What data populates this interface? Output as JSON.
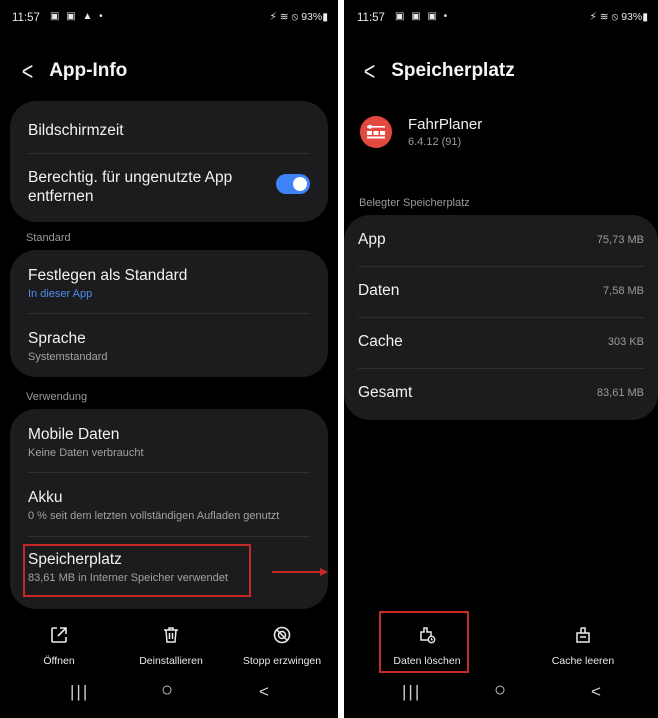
{
  "left": {
    "status": {
      "time": "11:57",
      "icons": "▣ ▣ ▲ •",
      "right": "⚡ ≋ ⦸ 93%▮"
    },
    "title": "App-Info",
    "items": {
      "screen_time": "Bildschirmzeit",
      "perm_remove": "Berechtig. für ungenutzte App entfernen",
      "set_default": "Festlegen als Standard",
      "set_default_sub": "In dieser App",
      "language": "Sprache",
      "language_sub": "Systemstandard",
      "mobile_data": "Mobile Daten",
      "mobile_data_sub": "Keine Daten verbraucht",
      "battery": "Akku",
      "battery_sub": "0 % seit dem letzten vollständigen Aufladen genutzt",
      "storage": "Speicherplatz",
      "storage_sub": "83,61 MB in Interner Speicher verwendet"
    },
    "toggle_on": true,
    "sections": {
      "standard": "Standard",
      "usage": "Verwendung"
    },
    "bottom": {
      "open": "Öffnen",
      "uninstall": "Deinstallieren",
      "force_stop": "Stopp erzwingen"
    },
    "icons": {
      "open": "open-icon",
      "uninstall": "trash-icon",
      "stop": "stop-icon"
    }
  },
  "right": {
    "status": {
      "time": "11:57",
      "icons": "▣ ▣ ▣ •",
      "right": "⚡ ≋ ⦸ 93%▮"
    },
    "title": "Speicherplatz",
    "app": {
      "name": "FahrPlaner",
      "version": "6.4.12 (91)"
    },
    "section": "Belegter Speicherplatz",
    "rows": [
      {
        "label": "App",
        "value": "75,73 MB"
      },
      {
        "label": "Daten",
        "value": "7,58 MB"
      },
      {
        "label": "Cache",
        "value": "303 KB"
      },
      {
        "label": "Gesamt",
        "value": "83,61 MB"
      }
    ],
    "bottom": {
      "clear_data": "Daten löschen",
      "clear_cache": "Cache leeren"
    }
  },
  "nav": {
    "recents": "|||",
    "home": "○",
    "back": "<"
  },
  "colors": {
    "accent": "#3e83f5",
    "highlight": "#c62828",
    "card": "#1c1c1e",
    "app_icon": "#e24a3f"
  }
}
